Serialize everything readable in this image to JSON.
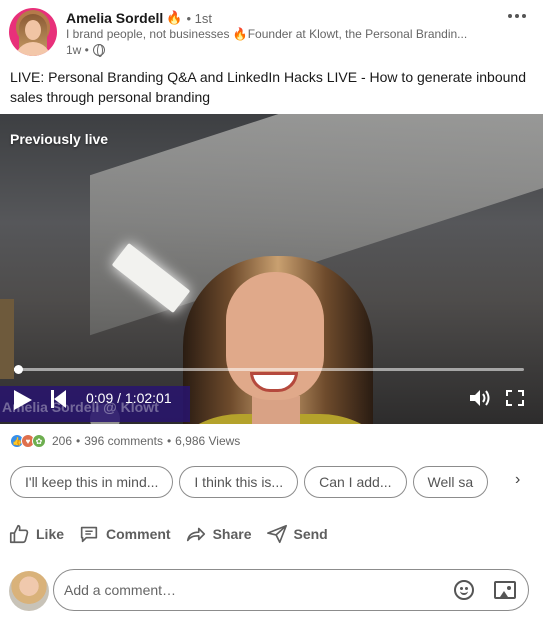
{
  "author": {
    "name": "Amelia Sordell",
    "name_emoji": "🔥",
    "degree": "• 1st",
    "headline": "I brand people, not businesses 🔥Founder at Klowt, the Personal Brandin...",
    "time": "1w •"
  },
  "post": {
    "text": "LIVE: Personal Branding Q&A and LinkedIn Hacks LIVE - How to generate inbound sales through personal branding"
  },
  "video": {
    "status_label": "Previously live",
    "time_readout": "0:09 / 1:02:01",
    "progress": 0.0024,
    "watermark": "Amelia Sordell @ Klowt"
  },
  "social": {
    "reaction_icons": [
      "like-reaction-icon",
      "love-reaction-icon",
      "support-reaction-icon"
    ],
    "reactions_count": "206",
    "comments": "396 comments",
    "views": "6,986 Views"
  },
  "suggestions": [
    "I'll keep this in mind...",
    "I think this is...",
    "Can I add...",
    "Well sa"
  ],
  "actions": {
    "like": "Like",
    "comment": "Comment",
    "share": "Share",
    "send": "Send"
  },
  "comment_box": {
    "placeholder": "Add a comment…"
  },
  "colors": {
    "text": "#191919",
    "muted": "#666666",
    "watermark_bg": "#28146e"
  }
}
